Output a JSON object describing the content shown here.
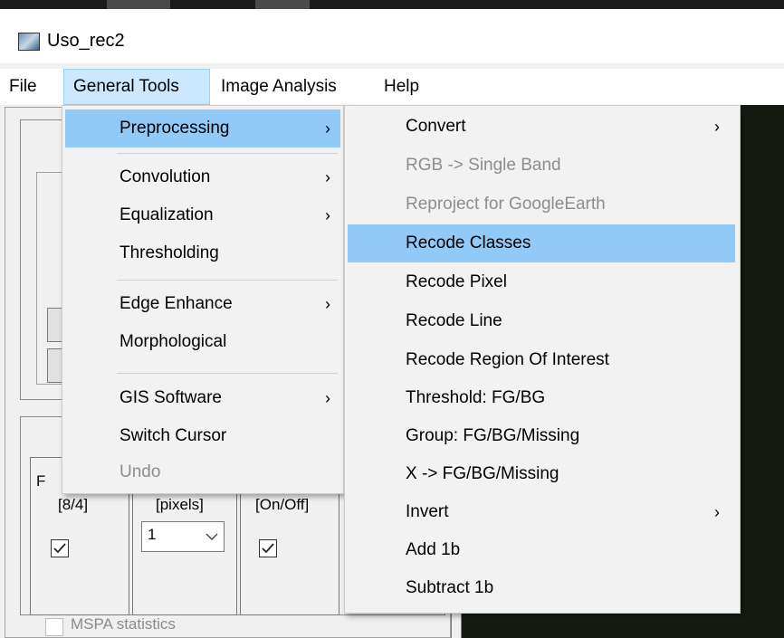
{
  "window": {
    "title": "Uso_rec2"
  },
  "menubar": {
    "items": [
      "File",
      "General Tools",
      "Image Analysis",
      "Help"
    ]
  },
  "general_tools_menu": {
    "items": [
      {
        "label": "Preprocessing",
        "submenu": true,
        "selected": true
      },
      {
        "label": "Convolution",
        "submenu": true
      },
      {
        "label": "Equalization",
        "submenu": true
      },
      {
        "label": "Thresholding",
        "submenu": false
      },
      {
        "label": "Edge Enhance",
        "submenu": true
      },
      {
        "label": "Morphological",
        "submenu": false
      },
      {
        "label": "GIS Software",
        "submenu": true
      },
      {
        "label": "Switch Cursor",
        "submenu": false
      },
      {
        "label": "Undo",
        "submenu": false,
        "disabled": true
      }
    ]
  },
  "preprocessing_menu": {
    "items": [
      {
        "label": "Convert",
        "submenu": true
      },
      {
        "label": "RGB -> Single Band",
        "disabled": true
      },
      {
        "label": "Reproject for GoogleEarth",
        "disabled": true
      },
      {
        "label": "Recode Classes",
        "selected": true
      },
      {
        "label": "Recode Pixel"
      },
      {
        "label": "Recode Line"
      },
      {
        "label": "Recode Region Of Interest"
      },
      {
        "label": "Threshold: FG/BG"
      },
      {
        "label": "Group: FG/BG/Missing"
      },
      {
        "label": "X -> FG/BG/Missing"
      },
      {
        "label": "Invert",
        "submenu": true
      },
      {
        "label": "Add 1b"
      },
      {
        "label": "Subtract 1b"
      }
    ]
  },
  "background_panel": {
    "cols": [
      {
        "head_top": "F",
        "head": "[8/4]",
        "checked": true
      },
      {
        "head": "[pixels]",
        "combo_value": "1"
      },
      {
        "head": "[On/Off]",
        "checked": true
      }
    ],
    "stats_label": "MSPA statistics",
    "stats_checked": false
  },
  "icons": {
    "submenu_arrow": "chevron-right-icon",
    "combo_arrow": "chevron-down-icon",
    "app": "app-icon"
  },
  "colors": {
    "menu_highlight": "#91c9f7",
    "menubar_active": "#cce8ff",
    "canvas": "#161b12"
  }
}
